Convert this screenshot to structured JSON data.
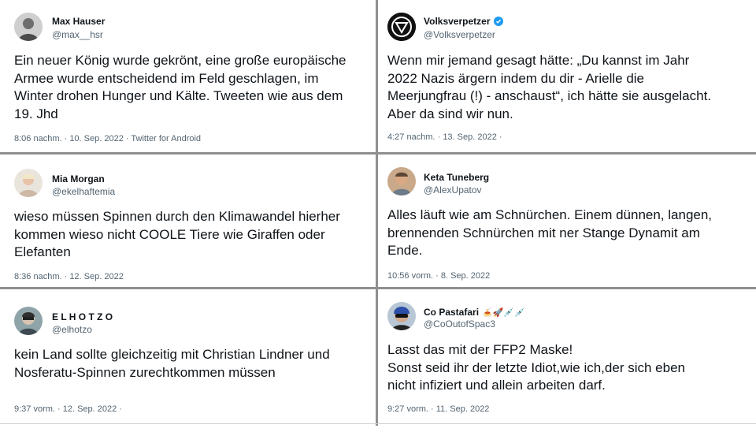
{
  "tweets": [
    {
      "name": "Max Hauser",
      "handle": "@max__hsr",
      "text": "Ein neuer König wurde gekrönt, eine große europäische\nArmee wurde entscheidend im Feld geschlagen, im\nWinter drohen Hunger und Kälte. Tweeten wie aus dem\n19. Jhd",
      "meta": "8:06 nachm. · 10. Sep. 2022 · Twitter for Android",
      "avatar": "avatar-bw-photo"
    },
    {
      "name": "Volksverpetzer",
      "handle": "@Volksverpetzer",
      "verified": true,
      "text": "Wenn mir jemand gesagt hätte: „Du kannst im Jahr\n2022 Nazis ärgern indem du dir - Arielle die\nMeerjungfrau (!) - anschaust“, ich hätte sie ausgelacht.\nAber da sind wir nun.",
      "meta": "4:27 nachm. · 13. Sep. 2022 ·",
      "avatar": "triangle-logo"
    },
    {
      "name": "Mia Morgan",
      "handle": "@ekelhaftemia",
      "text": "wieso müssen Spinnen durch den Klimawandel hierher\nkommen wieso nicht COOLE Tiere wie Giraffen oder\nElefanten",
      "meta": "8:36 nachm. · 12. Sep. 2022",
      "avatar": "avatar-photo"
    },
    {
      "name": "Keta Tuneberg",
      "handle": "@AlexUpatov",
      "text": "Alles läuft wie am Schnürchen. Einem dünnen, langen,\nbrennenden Schnürchen mit ner Stange Dynamit am\nEnde.",
      "meta": "10:56 vorm. · 8. Sep. 2022",
      "avatar": "avatar-photo"
    },
    {
      "name": "E L H O T Z O",
      "handle": "@elhotzo",
      "text": "kein Land sollte gleichzeitig mit Christian Lindner und\nNosferatu-Spinnen zurechtkommen müssen",
      "meta": "9:37 vorm. · 12. Sep. 2022 ·",
      "avatar": "avatar-photo"
    },
    {
      "name": "Co Pastafari",
      "name_emoji": "🍝🚀💉💉",
      "handle": "@CoOutofSpac3",
      "text": "Lasst das mit der FFP2 Maske!\nSonst seid ihr der letzte Idiot,wie ich,der  sich eben\nnicht infiziert und allein arbeiten darf.",
      "meta": "9:27 vorm. · 11. Sep. 2022",
      "avatar": "avatar-photo"
    }
  ],
  "colors": {
    "text": "#0f1419",
    "secondary": "#536471",
    "divider": "#8f8f8f",
    "verified": "#1d9bf0"
  }
}
